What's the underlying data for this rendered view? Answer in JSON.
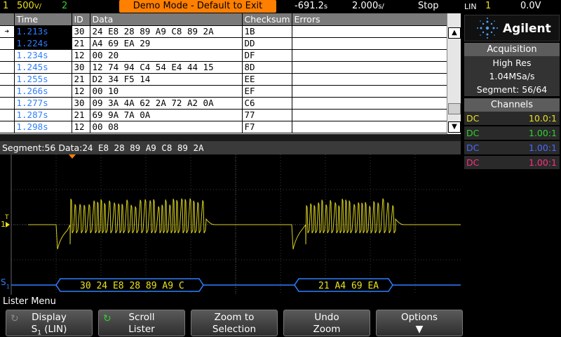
{
  "status_bar": {
    "channel1": "1",
    "channel1_scale": "500",
    "channel1_unit": "V/",
    "channel2": "2",
    "demo_banner": "Demo Mode - Default to Exit",
    "time_offset": "-691.2",
    "time_offset_unit": "s",
    "time_scale": "2.000",
    "time_scale_unit": "s/",
    "run_state": "Stop",
    "trigger_type": "LIN",
    "trigger_channel": "1",
    "trigger_level": "0.0V",
    "colors": {
      "ch1": "#e8e020",
      "ch2": "#30d030",
      "banner": "#ff7f00"
    }
  },
  "lister": {
    "columns": [
      "Time",
      "ID",
      "Data",
      "Checksum",
      "Errors"
    ],
    "rows": [
      {
        "time": "1.213s",
        "id": "30",
        "data": "24 E8 28 89 A9 C8 89 2A",
        "checksum": "1B",
        "errors": "",
        "selected": true,
        "marker": true
      },
      {
        "time": "1.224s",
        "id": "21",
        "data": "A4 69 EA 29",
        "checksum": "DD",
        "errors": "",
        "selected": true,
        "marker": false
      },
      {
        "time": "1.234s",
        "id": "12",
        "data": "00 20",
        "checksum": "DF",
        "errors": ""
      },
      {
        "time": "1.245s",
        "id": "30",
        "data": "12 74 94 C4 54 E4 44 15",
        "checksum": "8D",
        "errors": ""
      },
      {
        "time": "1.255s",
        "id": "21",
        "data": "D2 34 F5 14",
        "checksum": "EE",
        "errors": ""
      },
      {
        "time": "1.266s",
        "id": "12",
        "data": "00 10",
        "checksum": "EF",
        "errors": ""
      },
      {
        "time": "1.277s",
        "id": "30",
        "data": "09 3A 4A 62 2A 72 A2 0A",
        "checksum": "C6",
        "errors": ""
      },
      {
        "time": "1.287s",
        "id": "21",
        "data": "69 9A 7A 0A",
        "checksum": "77",
        "errors": ""
      },
      {
        "time": "1.298s",
        "id": "12",
        "data": "00 08",
        "checksum": "F7",
        "errors": ""
      }
    ]
  },
  "segment_line": {
    "label": "Segment:56 Data:",
    "bytes": "24 E8 28 89 A9 C8 89 2A"
  },
  "waveform": {
    "ch1_label": "1",
    "trigger_marker": "T",
    "serial_label": "S",
    "serial_sub": "1",
    "decode_frames": [
      {
        "text": "30 24 E8 28 89 A9 C"
      },
      {
        "text": "21 A4 69 EA"
      }
    ],
    "colors": {
      "trace": "#d8d020",
      "decode": "#2f7fff",
      "decode_text": "#e8e020",
      "grid": "#3a3a3a",
      "trigger_mark": "#ff7f00"
    }
  },
  "right_panel": {
    "brand": "Agilent",
    "acquisition_title": "Acquisition",
    "acq_mode": "High Res",
    "sample_rate": "1.04MSa/s",
    "segment": "Segment: 56/64",
    "channels_title": "Channels",
    "channels": [
      {
        "coupling": "DC",
        "probe": "10.0:1",
        "color": "#e8e020"
      },
      {
        "coupling": "DC",
        "probe": "1.00:1",
        "color": "#30d030"
      },
      {
        "coupling": "DC",
        "probe": "1.00:1",
        "color": "#4a6aff"
      },
      {
        "coupling": "DC",
        "probe": "1.00:1",
        "color": "#ff3080"
      }
    ]
  },
  "menu": {
    "title": "Lister Menu",
    "softkeys": [
      {
        "line1": "Display",
        "line2": "S",
        "line2_sub": "1",
        "line2_tail": " (LIN)"
      },
      {
        "line1": "Scroll",
        "line2": "Lister"
      },
      {
        "line1": "Zoom to",
        "line2": "Selection"
      },
      {
        "line1": "Undo",
        "line2": "Zoom"
      },
      {
        "line1": "Options",
        "line2": ""
      }
    ]
  }
}
